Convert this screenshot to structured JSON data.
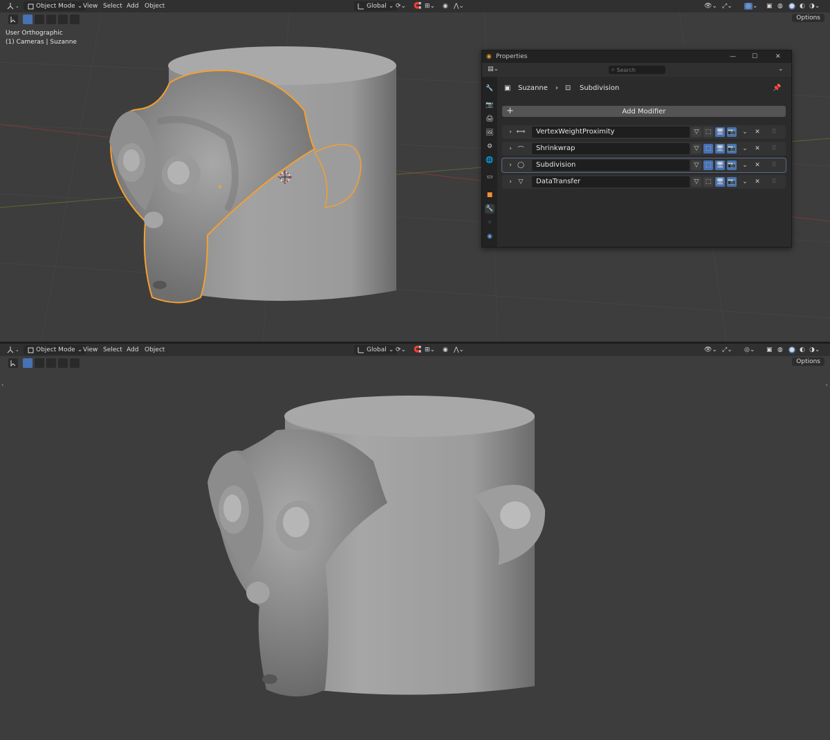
{
  "header": {
    "mode": "Object Mode",
    "menu": [
      "View",
      "Select",
      "Add",
      "Object"
    ],
    "orientation": "Global",
    "options": "Options"
  },
  "viewport_top": {
    "view_name": "User Orthographic",
    "collection_info": "(1) Cameras | Suzanne"
  },
  "properties": {
    "title": "Properties",
    "search_placeholder": "Search",
    "breadcrumb_object": "Suzanne",
    "breadcrumb_modifier": "Subdivision",
    "add_modifier": "Add Modifier",
    "modifiers": [
      {
        "name": "VertexWeightProximity",
        "icon": "vertex-weight-icon",
        "active": false,
        "edit_mode": false
      },
      {
        "name": "Shrinkwrap",
        "icon": "shrinkwrap-icon",
        "active": false,
        "edit_mode": true
      },
      {
        "name": "Subdivision",
        "icon": "subdivision-icon",
        "active": true,
        "edit_mode": true
      },
      {
        "name": "DataTransfer",
        "icon": "data-transfer-icon",
        "active": false,
        "edit_mode": false
      }
    ]
  },
  "colors": {
    "accent_blue": "#4772b3",
    "selection_orange": "#f5a030",
    "viewport_bg": "#3d3d3d",
    "header_bg": "#303030"
  }
}
